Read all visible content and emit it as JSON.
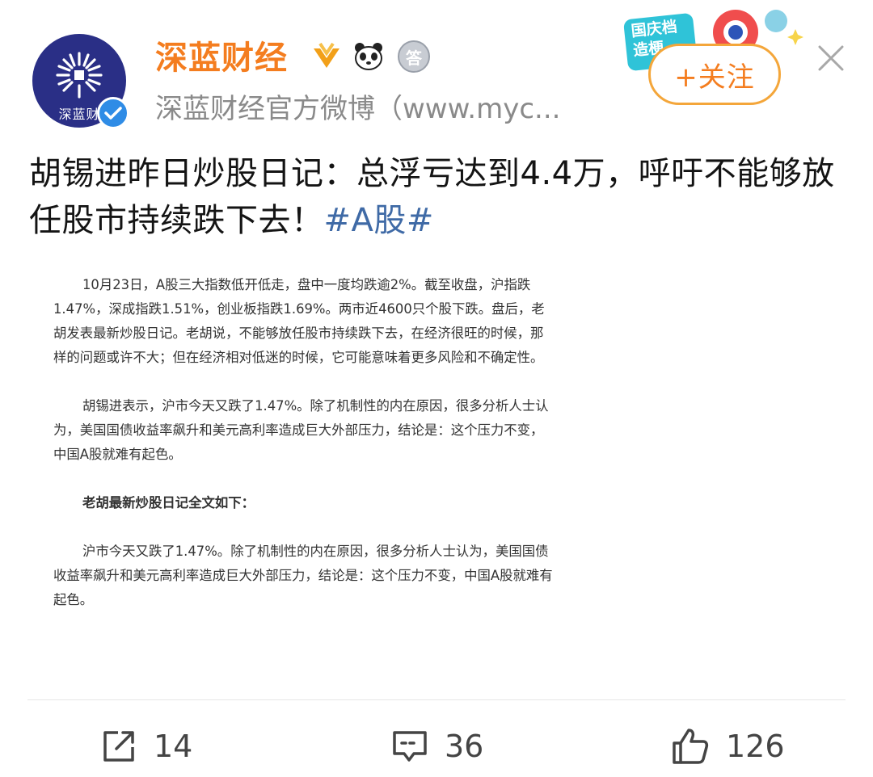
{
  "header": {
    "avatar_text": "深蓝财",
    "account_name": "深蓝财经",
    "subtitle": "深蓝财经官方微博（www.myc...",
    "badges": [
      "gold-v-badge",
      "panda-badge",
      "silver-medal-badge"
    ],
    "medal_char": "答"
  },
  "promo": {
    "line1": "国庆档",
    "line2": "造梗"
  },
  "follow_button": {
    "label": "+关注"
  },
  "post": {
    "headline": "胡锡进昨日炒股日记：总浮亏达到4.4万，呼吁不能够放任股市持续跌下去！",
    "hashtag": "#A股#",
    "paragraphs": [
      "10月23日，A股三大指数低开低走，盘中一度均跌逾2%。截至收盘，沪指跌1.47%，深成指跌1.51%，创业板指跌1.69%。两市近4600只个股下跌。盘后，老胡发表最新炒股日记。老胡说，不能够放任股市持续跌下去，在经济很旺的时候，那样的问题或许不大；但在经济相对低迷的时候，它可能意味着更多风险和不确定性。",
      "胡锡进表示，沪市今天又跌了1.47%。除了机制性的内在原因，很多分析人士认为，美国国债收益率飙升和美元高利率造成巨大外部压力，结论是：这个压力不变，中国A股就难有起色。",
      "老胡最新炒股日记全文如下：",
      "沪市今天又跌了1.47%。除了机制性的内在原因，很多分析人士认为，美国国债收益率飙升和美元高利率造成巨大外部压力，结论是：这个压力不变，中国A股就难有起色。"
    ]
  },
  "actions": {
    "share": {
      "icon": "share-icon",
      "count": "14"
    },
    "comment": {
      "icon": "comment-icon",
      "count": "36"
    },
    "like": {
      "icon": "thumbs-up-icon",
      "count": "126"
    }
  },
  "colors": {
    "name_orange": "#f47d1f",
    "hashtag_blue": "#3f6aa6",
    "avatar_navy": "#2a2f86",
    "verify_blue": "#2f8ce6"
  }
}
